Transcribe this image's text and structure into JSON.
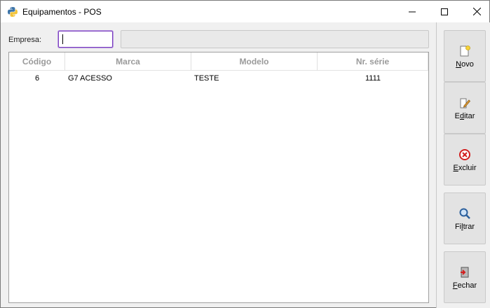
{
  "window": {
    "title": "Equipamentos - POS"
  },
  "form": {
    "empresa_label": "Empresa:",
    "empresa_value": "",
    "empresa_desc": ""
  },
  "grid": {
    "columns": [
      "Código",
      "Marca",
      "Modelo",
      "Nr. série"
    ],
    "rows": [
      {
        "codigo": "6",
        "marca": "G7 ACESSO",
        "modelo": "TESTE",
        "serie": "1111"
      }
    ]
  },
  "sidebar": {
    "novo": "Novo",
    "editar": "Editar",
    "excluir": "Excluir",
    "filtrar": "Filtrar",
    "fechar": "Fechar"
  },
  "colors": {
    "focus_border": "#7b3fbf",
    "header_text": "#9a9a9a",
    "button_bg": "#e3e3e3"
  }
}
